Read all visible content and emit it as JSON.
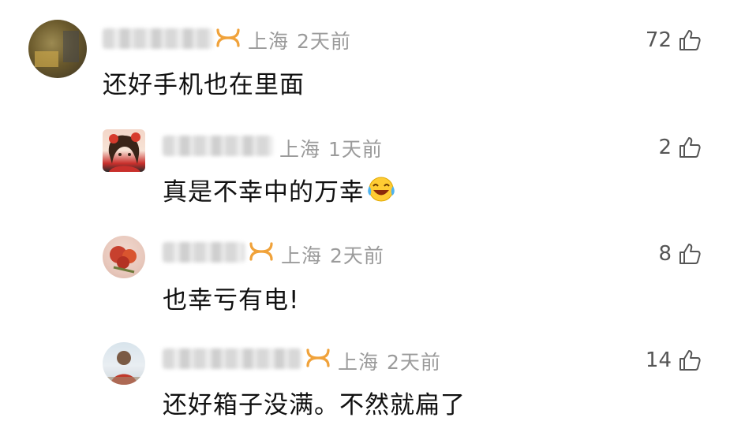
{
  "comments": [
    {
      "location": "上海",
      "time": "2天前",
      "likes": "72",
      "text": "还好手机也在里面",
      "vip": true,
      "avatar_icon": "user-avatar-icon"
    },
    {
      "location": "上海",
      "time": "1天前",
      "likes": "2",
      "text": "真是不幸中的万幸",
      "vip": false,
      "emoji": "laughing-tears-emoji",
      "avatar_icon": "anime-girl-avatar-icon"
    },
    {
      "location": "上海",
      "time": "2天前",
      "likes": "8",
      "text": "也幸亏有电!",
      "vip": true,
      "avatar_icon": "flower-avatar-icon"
    },
    {
      "location": "上海",
      "time": "2天前",
      "likes": "14",
      "text": "还好箱子没满。不然就扁了",
      "vip": true,
      "avatar_icon": "person-avatar-icon"
    }
  ],
  "colors": {
    "meta_text": "#9b9b9b",
    "vip_gold": "#f0a23a",
    "body_text": "#111111"
  }
}
